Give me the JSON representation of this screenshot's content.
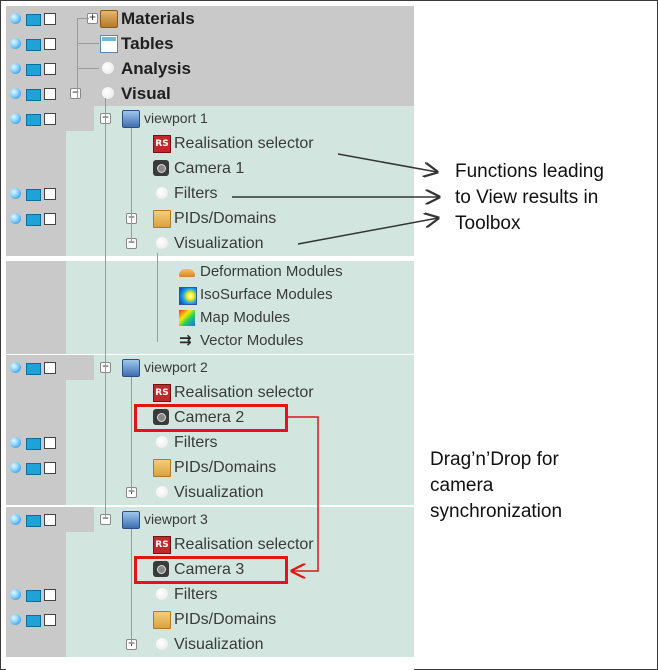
{
  "tree": {
    "top": [
      {
        "label": "Materials",
        "icon": "materials-icon"
      },
      {
        "label": "Tables",
        "icon": "table-icon"
      },
      {
        "label": "Analysis",
        "icon": "node-dot-icon"
      },
      {
        "label": "Visual",
        "icon": "node-dot-icon"
      }
    ],
    "viewport1": {
      "label": "viewport 1",
      "realisation": "Realisation selector",
      "rs_badge": "RS",
      "camera": "Camera 1",
      "filters": "Filters",
      "pids": "PIDs/Domains",
      "visualization": "Visualization",
      "modules": [
        "Deformation Modules",
        "IsoSurface Modules",
        "Map Modules",
        "Vector Modules"
      ]
    },
    "viewport2": {
      "label": "viewport 2",
      "realisation": "Realisation selector",
      "rs_badge": "RS",
      "camera": "Camera 2",
      "filters": "Filters",
      "pids": "PIDs/Domains",
      "visualization": "Visualization"
    },
    "viewport3": {
      "label": "viewport 3",
      "realisation": "Realisation selector",
      "rs_badge": "RS",
      "camera": "Camera 3",
      "filters": "Filters",
      "pids": "PIDs/Domains",
      "visualization": "Visualization"
    }
  },
  "annotations": {
    "functions_note": [
      "Functions leading",
      "to View results in",
      "Toolbox"
    ],
    "drag_note": [
      "Drag’n’Drop for",
      "camera",
      "synchronization"
    ]
  },
  "colors": {
    "header_bg": "#c9c9c9",
    "node_bg": "#d2e6df",
    "highlight": "#e01515"
  }
}
